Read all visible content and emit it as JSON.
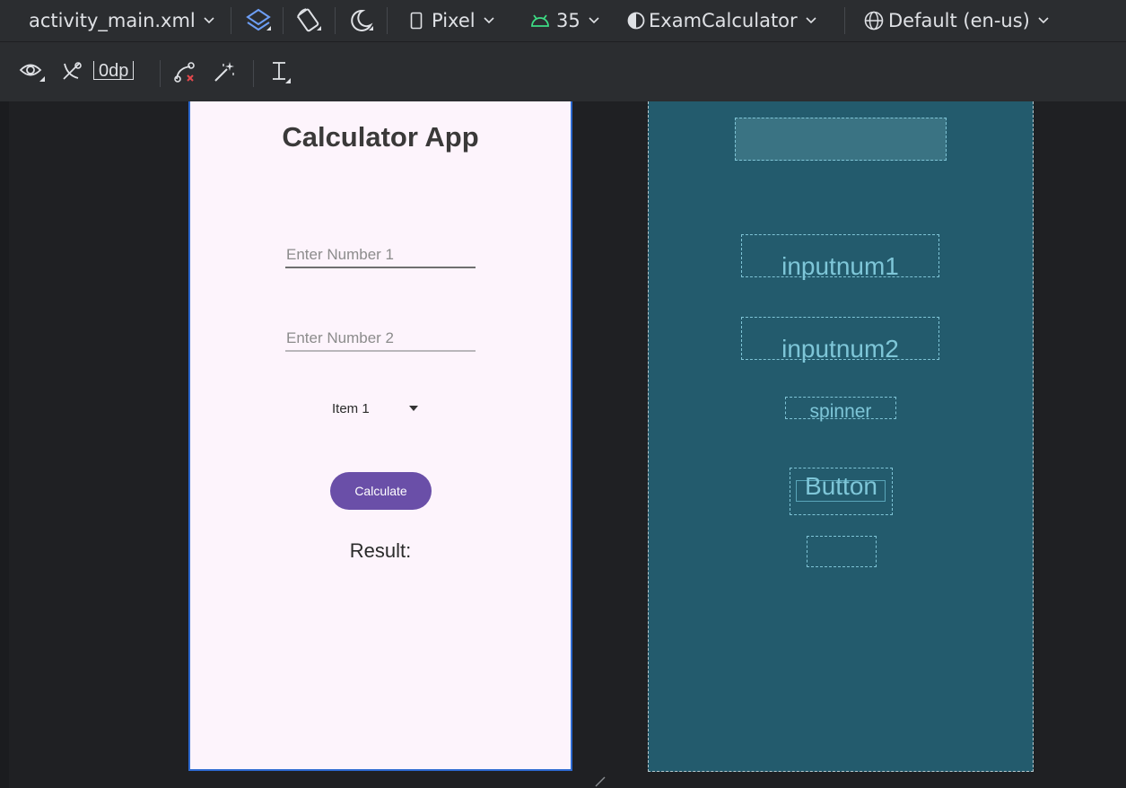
{
  "toolbar": {
    "file_name": "activity_main.xml",
    "device": "Pixel",
    "api_level": "35",
    "theme": "ExamCalculator",
    "locale": "Default (en-us)",
    "margin_value": "0dp",
    "icons": [
      "design-surface-layers-icon",
      "orientation-icon",
      "night-mode-icon",
      "device-icon",
      "android-api-icon",
      "theme-icon",
      "globe-icon",
      "view-options-eye-icon",
      "autoconnect-off-icon",
      "clear-constraints-icon",
      "infer-constraints-icon",
      "baseline-guidelines-icon"
    ]
  },
  "design": {
    "title": "Calculator App",
    "input1_placeholder": "Enter Number 1",
    "input2_placeholder": "Enter Number 2",
    "spinner_value": "Item 1",
    "button_label": "Calculate",
    "result_label": "Result:",
    "colors": {
      "surface": "#fdf4fc",
      "button": "#6a4fa8",
      "selection_border": "#2e6ad1"
    }
  },
  "blueprint": {
    "input1_label": "inputnum1",
    "input2_label": "inputnum2",
    "spinner_label": "spinner",
    "button_label": "Button",
    "colors": {
      "background": "#235b6d",
      "outline": "#7fc4d6"
    }
  }
}
